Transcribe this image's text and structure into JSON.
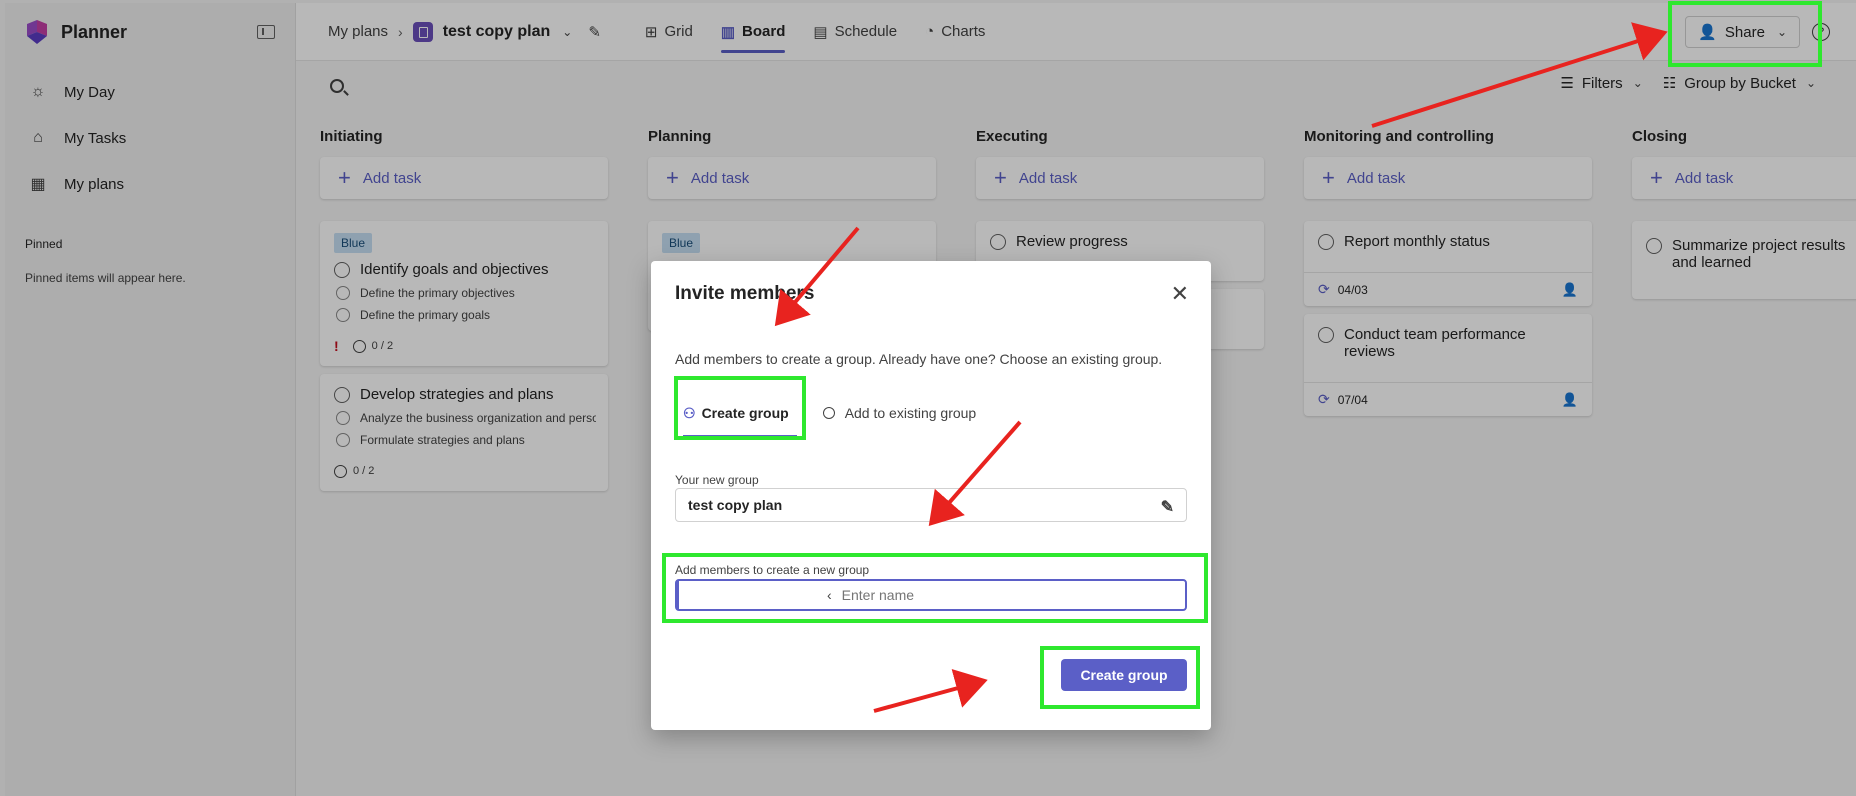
{
  "app": {
    "title": "Planner"
  },
  "sidebar": {
    "items": [
      {
        "label": "My Day",
        "icon": "sun-icon"
      },
      {
        "label": "My Tasks",
        "icon": "task-check-icon"
      },
      {
        "label": "My plans",
        "icon": "grid-icon"
      }
    ],
    "pinned_title": "Pinned",
    "pinned_empty": "Pinned items will appear here."
  },
  "header": {
    "breadcrumb": "My plans",
    "plan_name": "test copy plan",
    "tabs": [
      "Grid",
      "Board",
      "Schedule",
      "Charts"
    ],
    "active_tab": "Board",
    "share_label": "Share"
  },
  "toolbar": {
    "filters": "Filters",
    "group_by": "Group by Bucket"
  },
  "board": {
    "add_task": "Add task",
    "label_blue": "Blue",
    "buckets": [
      {
        "title": "Initiating"
      },
      {
        "title": "Planning"
      },
      {
        "title": "Executing"
      },
      {
        "title": "Monitoring and controlling"
      },
      {
        "title": "Closing"
      }
    ],
    "initiating_cards": [
      {
        "title": "Identify goals and objectives",
        "subtasks": [
          "Define the primary objectives",
          "Define the primary goals"
        ],
        "progress": "0 / 2"
      },
      {
        "title": "Develop strategies and plans",
        "subtasks": [
          "Analyze the business organization and perso",
          "Formulate strategies and plans"
        ],
        "progress": "0 / 2"
      }
    ],
    "executing_cards": [
      {
        "title": "Review progress"
      }
    ],
    "monitoring_cards": [
      {
        "title": "Report monthly status",
        "date": "04/03"
      },
      {
        "title": "Conduct team performance reviews",
        "date": "07/04"
      }
    ],
    "closing_cards": [
      {
        "title": "Summarize project results and learned"
      }
    ]
  },
  "dialog": {
    "title": "Invite members",
    "description": "Add members to create a group. Already have one? Choose an existing group.",
    "tab_create": "Create group",
    "tab_existing": "Add to existing group",
    "group_label": "Your new group",
    "group_value": "test copy plan",
    "members_label": "Add members to create a new group",
    "members_placeholder": "Enter name",
    "create_button": "Create group"
  },
  "annotation_colors": {
    "highlight": "#2ee82e",
    "arrow": "#e8231f",
    "accent": "#5b5fc7"
  }
}
